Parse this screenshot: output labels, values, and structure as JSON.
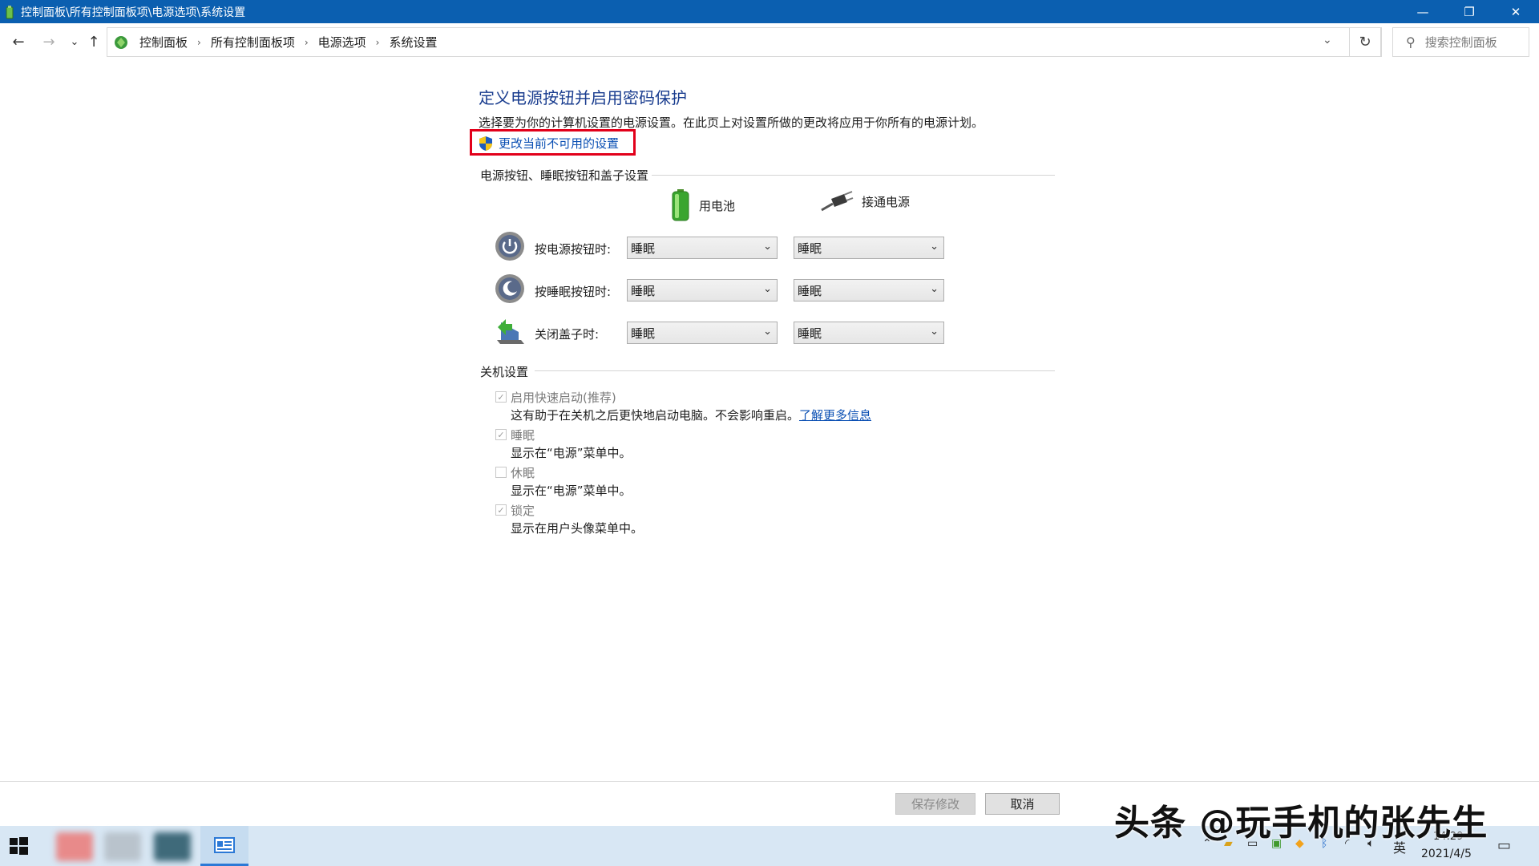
{
  "window": {
    "title": "控制面板\\所有控制面板项\\电源选项\\系统设置",
    "minimize_glyph": "—",
    "maximize_glyph": "❐",
    "close_glyph": "✕"
  },
  "address_bar": {
    "breadcrumbs": [
      "控制面板",
      "所有控制面板项",
      "电源选项",
      "系统设置"
    ],
    "search_placeholder": "搜索控制面板"
  },
  "page": {
    "heading": "定义电源按钮并启用密码保护",
    "description": "选择要为你的计算机设置的电源设置。在此页上对设置所做的更改将应用于你所有的电源计划。",
    "change_link": "更改当前不可用的设置"
  },
  "power_section": {
    "title": "电源按钮、睡眠按钮和盖子设置",
    "column_battery": "用电池",
    "column_plugged": "接通电源",
    "rows": [
      {
        "label": "按电源按钮时:",
        "battery": "睡眠",
        "plugged": "睡眠"
      },
      {
        "label": "按睡眠按钮时:",
        "battery": "睡眠",
        "plugged": "睡眠"
      },
      {
        "label": "关闭盖子时:",
        "battery": "睡眠",
        "plugged": "睡眠"
      }
    ]
  },
  "shutdown_section": {
    "title": "关机设置",
    "items": [
      {
        "label": "启用快速启动(推荐)",
        "checked": true,
        "description": "这有助于在关机之后更快地启动电脑。不会影响重启。",
        "link": "了解更多信息"
      },
      {
        "label": "睡眠",
        "checked": true,
        "description": "显示在“电源”菜单中。"
      },
      {
        "label": "休眠",
        "checked": false,
        "description": "显示在“电源”菜单中。"
      },
      {
        "label": "锁定",
        "checked": true,
        "description": "显示在用户头像菜单中。"
      }
    ]
  },
  "buttons": {
    "save": "保存修改",
    "cancel": "取消"
  },
  "taskbar": {
    "ime": "英",
    "time": "14:29",
    "date": "2021/4/5"
  },
  "watermark": "头条 @玩手机的张先生",
  "colors": {
    "titlebar": "#0b5fb0",
    "heading": "#1a3d8f",
    "link": "#0a4fb3",
    "highlight": "#e2001a",
    "taskbar": "#d8e7f4"
  }
}
